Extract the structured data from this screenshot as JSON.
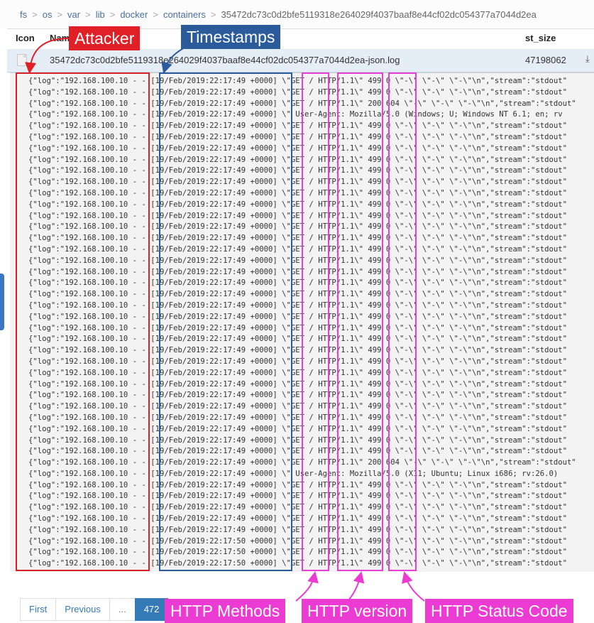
{
  "breadcrumb": [
    "fs",
    "os",
    "var",
    "lib",
    "docker",
    "containers",
    "35472dc73c0d2bfe5119318e264029f4037baaf8e44cf02dc054377a7044d2ea"
  ],
  "table": {
    "headers": {
      "icon": "Icon",
      "name": "Name",
      "size": "st_size"
    },
    "file": {
      "name": "35472dc73c0d2bfe5119318e264029f4037baaf8e44cf02dc054377a7044d2ea-json.log",
      "size": "47198062"
    }
  },
  "log_lines": [
    "{\"log\":\"192.168.100.10 - - [19/Feb/2019:22:17:49 +0000] \\\"GET / HTTP/1.1\\\" 499 0 \\\"-\\\" \\\"-\\\" \\\"-\\\"\\n\",\"stream\":\"stdout\"",
    "{\"log\":\"192.168.100.10 - - [19/Feb/2019:22:17:49 +0000] \\\"GET / HTTP/1.1\\\" 499 0 \\\"-\\\" \\\"-\\\" \\\"-\\\"\\n\",\"stream\":\"stdout\"",
    "{\"log\":\"192.168.100.10 - - [19/Feb/2019:22:17:49 +0000] \\\"GET / HTTP/1.1\\\" 200 604 \\\"-\\\" \\\"-\\\" \\\"-\\\"\\n\",\"stream\":\"stdout\"",
    "{\"log\":\"192.168.100.10 - - [19/Feb/2019:22:17:49 +0000] \\\" User-Agent: Mozilla/5.0 (Windows; U; Windows NT 6.1; en; rv",
    "{\"log\":\"192.168.100.10 - - [19/Feb/2019:22:17:49 +0000] \\\"GET / HTTP/1.1\\\" 499 0 \\\"-\\\" \\\"-\\\" \\\"-\\\"\\n\",\"stream\":\"stdout\"",
    "{\"log\":\"192.168.100.10 - - [19/Feb/2019:22:17:49 +0000] \\\"GET / HTTP/1.1\\\" 499 0 \\\"-\\\" \\\"-\\\" \\\"-\\\"\\n\",\"stream\":\"stdout\"",
    "{\"log\":\"192.168.100.10 - - [19/Feb/2019:22:17:49 +0000] \\\"GET / HTTP/1.1\\\" 499 0 \\\"-\\\" \\\"-\\\" \\\"-\\\"\\n\",\"stream\":\"stdout\"",
    "{\"log\":\"192.168.100.10 - - [19/Feb/2019:22:17:49 +0000] \\\"GET / HTTP/1.1\\\" 499 0 \\\"-\\\" \\\"-\\\" \\\"-\\\"\\n\",\"stream\":\"stdout\"",
    "{\"log\":\"192.168.100.10 - - [19/Feb/2019:22:17:49 +0000] \\\"GET / HTTP/1.1\\\" 499 0 \\\"-\\\" \\\"-\\\" \\\"-\\\"\\n\",\"stream\":\"stdout\"",
    "{\"log\":\"192.168.100.10 - - [19/Feb/2019:22:17:49 +0000] \\\"GET / HTTP/1.1\\\" 499 0 \\\"-\\\" \\\"-\\\" \\\"-\\\"\\n\",\"stream\":\"stdout\"",
    "{\"log\":\"192.168.100.10 - - [19/Feb/2019:22:17:49 +0000] \\\"GET / HTTP/1.1\\\" 499 0 \\\"-\\\" \\\"-\\\" \\\"-\\\"\\n\",\"stream\":\"stdout\"",
    "{\"log\":\"192.168.100.10 - - [19/Feb/2019:22:17:49 +0000] \\\"GET / HTTP/1.1\\\" 499 0 \\\"-\\\" \\\"-\\\" \\\"-\\\"\\n\",\"stream\":\"stdout\"",
    "{\"log\":\"192.168.100.10 - - [19/Feb/2019:22:17:49 +0000] \\\"GET / HTTP/1.1\\\" 499 0 \\\"-\\\" \\\"-\\\" \\\"-\\\"\\n\",\"stream\":\"stdout\"",
    "{\"log\":\"192.168.100.10 - - [19/Feb/2019:22:17:49 +0000] \\\"GET / HTTP/1.1\\\" 499 0 \\\"-\\\" \\\"-\\\" \\\"-\\\"\\n\",\"stream\":\"stdout\"",
    "{\"log\":\"192.168.100.10 - - [19/Feb/2019:22:17:49 +0000] \\\"GET / HTTP/1.1\\\" 499 0 \\\"-\\\" \\\"-\\\" \\\"-\\\"\\n\",\"stream\":\"stdout\"",
    "{\"log\":\"192.168.100.10 - - [19/Feb/2019:22:17:49 +0000] \\\"GET / HTTP/1.1\\\" 499 0 \\\"-\\\" \\\"-\\\" \\\"-\\\"\\n\",\"stream\":\"stdout\"",
    "{\"log\":\"192.168.100.10 - - [19/Feb/2019:22:17:49 +0000] \\\"GET / HTTP/1.1\\\" 499 0 \\\"-\\\" \\\"-\\\" \\\"-\\\"\\n\",\"stream\":\"stdout\"",
    "{\"log\":\"192.168.100.10 - - [19/Feb/2019:22:17:49 +0000] \\\"GET / HTTP/1.1\\\" 499 0 \\\"-\\\" \\\"-\\\" \\\"-\\\"\\n\",\"stream\":\"stdout\"",
    "{\"log\":\"192.168.100.10 - - [19/Feb/2019:22:17:49 +0000] \\\"GET / HTTP/1.1\\\" 499 0 \\\"-\\\" \\\"-\\\" \\\"-\\\"\\n\",\"stream\":\"stdout\"",
    "{\"log\":\"192.168.100.10 - - [19/Feb/2019:22:17:49 +0000] \\\"GET / HTTP/1.1\\\" 499 0 \\\"-\\\" \\\"-\\\" \\\"-\\\"\\n\",\"stream\":\"stdout\"",
    "{\"log\":\"192.168.100.10 - - [19/Feb/2019:22:17:49 +0000] \\\"GET / HTTP/1.1\\\" 499 0 \\\"-\\\" \\\"-\\\" \\\"-\\\"\\n\",\"stream\":\"stdout\"",
    "{\"log\":\"192.168.100.10 - - [19/Feb/2019:22:17:49 +0000] \\\"GET / HTTP/1.1\\\" 499 0 \\\"-\\\" \\\"-\\\" \\\"-\\\"\\n\",\"stream\":\"stdout\"",
    "{\"log\":\"192.168.100.10 - - [19/Feb/2019:22:17:49 +0000] \\\"GET / HTTP/1.1\\\" 499 0 \\\"-\\\" \\\"-\\\" \\\"-\\\"\\n\",\"stream\":\"stdout\"",
    "{\"log\":\"192.168.100.10 - - [19/Feb/2019:22:17:49 +0000] \\\"GET / HTTP/1.1\\\" 499 0 \\\"-\\\" \\\"-\\\" \\\"-\\\"\\n\",\"stream\":\"stdout\"",
    "{\"log\":\"192.168.100.10 - - [19/Feb/2019:22:17:49 +0000] \\\"GET / HTTP/1.1\\\" 499 0 \\\"-\\\" \\\"-\\\" \\\"-\\\"\\n\",\"stream\":\"stdout\"",
    "{\"log\":\"192.168.100.10 - - [19/Feb/2019:22:17:49 +0000] \\\"GET / HTTP/1.1\\\" 499 0 \\\"-\\\" \\\"-\\\" \\\"-\\\"\\n\",\"stream\":\"stdout\"",
    "{\"log\":\"192.168.100.10 - - [19/Feb/2019:22:17:49 +0000] \\\"GET / HTTP/1.1\\\" 499 0 \\\"-\\\" \\\"-\\\" \\\"-\\\"\\n\",\"stream\":\"stdout\"",
    "{\"log\":\"192.168.100.10 - - [19/Feb/2019:22:17:49 +0000] \\\"GET / HTTP/1.1\\\" 499 0 \\\"-\\\" \\\"-\\\" \\\"-\\\"\\n\",\"stream\":\"stdout\"",
    "{\"log\":\"192.168.100.10 - - [19/Feb/2019:22:17:49 +0000] \\\"GET / HTTP/1.1\\\" 499 0 \\\"-\\\" \\\"-\\\" \\\"-\\\"\\n\",\"stream\":\"stdout\"",
    "{\"log\":\"192.168.100.10 - - [19/Feb/2019:22:17:49 +0000] \\\"GET / HTTP/1.1\\\" 499 0 \\\"-\\\" \\\"-\\\" \\\"-\\\"\\n\",\"stream\":\"stdout\"",
    "{\"log\":\"192.168.100.10 - - [19/Feb/2019:22:17:49 +0000] \\\"GET / HTTP/1.1\\\" 499 0 \\\"-\\\" \\\"-\\\" \\\"-\\\"\\n\",\"stream\":\"stdout\"",
    "{\"log\":\"192.168.100.10 - - [19/Feb/2019:22:17:49 +0000] \\\"GET / HTTP/1.1\\\" 499 0 \\\"-\\\" \\\"-\\\" \\\"-\\\"\\n\",\"stream\":\"stdout\"",
    "{\"log\":\"192.168.100.10 - - [19/Feb/2019:22:17:49 +0000] \\\"GET / HTTP/1.1\\\" 499 0 \\\"-\\\" \\\"-\\\" \\\"-\\\"\\n\",\"stream\":\"stdout\"",
    "{\"log\":\"192.168.100.10 - - [19/Feb/2019:22:17:49 +0000] \\\"GET / HTTP/1.1\\\" 499 0 \\\"-\\\" \\\"-\\\" \\\"-\\\"\\n\",\"stream\":\"stdout\"",
    "{\"log\":\"192.168.100.10 - - [19/Feb/2019:22:17:49 +0000] \\\"GET / HTTP/1.1\\\" 200 604 \\\"-\\\" \\\"-\\\" \\\"-\\\"\\n\",\"stream\":\"stdout\"",
    "{\"log\":\"192.168.100.10 - - [19/Feb/2019:22:17:49 +0000] \\\" User-Agent: Mozilla/5.0 (X11; Ubuntu; Linux i686; rv:26.0)",
    "{\"log\":\"192.168.100.10 - - [19/Feb/2019:22:17:49 +0000] \\\"GET / HTTP/1.1\\\" 499 0 \\\"-\\\" \\\"-\\\" \\\"-\\\"\\n\",\"stream\":\"stdout\"",
    "{\"log\":\"192.168.100.10 - - [19/Feb/2019:22:17:49 +0000] \\\"GET / HTTP/1.1\\\" 499 0 \\\"-\\\" \\\"-\\\" \\\"-\\\"\\n\",\"stream\":\"stdout\"",
    "{\"log\":\"192.168.100.10 - - [19/Feb/2019:22:17:49 +0000] \\\"GET / HTTP/1.1\\\" 499 0 \\\"-\\\" \\\"-\\\" \\\"-\\\"\\n\",\"stream\":\"stdout\"",
    "{\"log\":\"192.168.100.10 - - [19/Feb/2019:22:17:49 +0000] \\\"GET / HTTP/1.1\\\" 499 0 \\\"-\\\" \\\"-\\\" \\\"-\\\"\\n\",\"stream\":\"stdout\"",
    "{\"log\":\"192.168.100.10 - - [19/Feb/2019:22:17:49 +0000] \\\"GET / HTTP/1.1\\\" 499 0 \\\"-\\\" \\\"-\\\" \\\"-\\\"\\n\",\"stream\":\"stdout\"",
    "{\"log\":\"192.168.100.10 - - [19/Feb/2019:22:17:50 +0000] \\\"GET / HTTP/1.1\\\" 499 0 \\\"-\\\" \\\"-\\\" \\\"-\\\"\\n\",\"stream\":\"stdout\"",
    "{\"log\":\"192.168.100.10 - - [19/Feb/2019:22:17:50 +0000] \\\"GET / HTTP/1.1\\\" 499 0 \\\"-\\\" \\\"-\\\" \\\"-\\\"\\n\",\"stream\":\"stdout\"",
    "{\"log\":\"192.168.100.10 - - [19/Feb/2019:22:17:50 +0000] \\\"GET / HTTP/1.1\\\" 499 0 \\\"-\\\" \\\"-\\\" \\\"-\\\"\\n\",\"stream\":\"stdout\""
  ],
  "annotations": {
    "attacker": "Attacker",
    "timestamps": "Timestamps",
    "methods": "HTTP Methods",
    "version": "HTTP version",
    "status": "HTTP Status Code"
  },
  "pagination": {
    "first": "First",
    "previous": "Previous",
    "ellipsis": "...",
    "current": "472"
  },
  "icons": {
    "file": "file-icon",
    "download": "download-icon"
  },
  "colors": {
    "attacker": "#e11f26",
    "timestamps": "#2b5b9a",
    "highlight": "#ec3bd2",
    "link": "#337ab7"
  }
}
